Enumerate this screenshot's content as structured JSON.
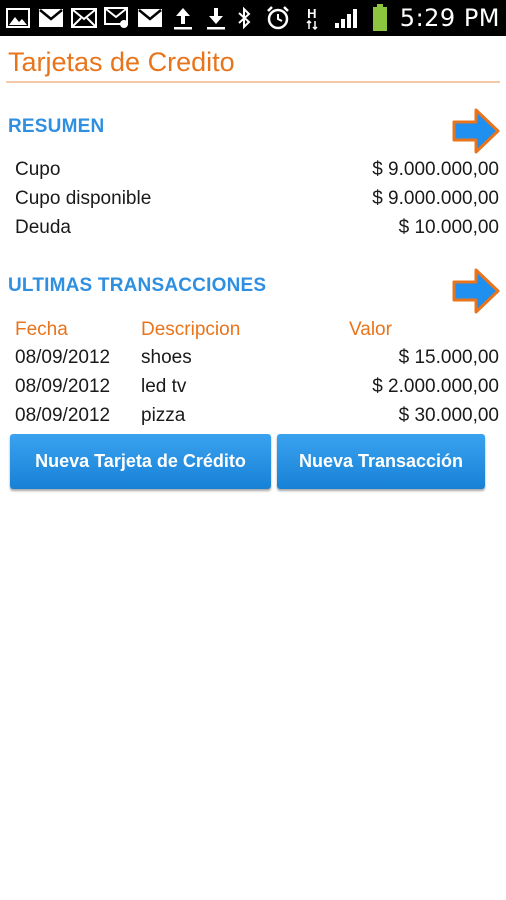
{
  "statusbar": {
    "icons": [
      "image-icon",
      "gmail-icon",
      "email-icon",
      "email-alert-icon",
      "gmail-icon",
      "upload-icon",
      "download-icon",
      "bluetooth-icon",
      "alarm-icon",
      "hspa-icon",
      "signal-icon",
      "battery-icon"
    ],
    "network_label": "H",
    "time": "5:29 PM"
  },
  "page": {
    "title": "Tarjetas de Credito"
  },
  "resumen": {
    "heading": "RESUMEN",
    "rows": [
      {
        "label": "Cupo",
        "value": "$ 9.000.000,00"
      },
      {
        "label": "Cupo disponible",
        "value": "$ 9.000.000,00"
      },
      {
        "label": "Deuda",
        "value": "$ 10.000,00"
      }
    ]
  },
  "transacciones": {
    "heading": "ULTIMAS TRANSACCIONES",
    "columns": {
      "fecha": "Fecha",
      "descripcion": "Descripcion",
      "valor": "Valor"
    },
    "rows": [
      {
        "fecha": "08/09/2012",
        "descripcion": "shoes",
        "valor": "$ 15.000,00"
      },
      {
        "fecha": "08/09/2012",
        "descripcion": "led tv",
        "valor": "$ 2.000.000,00"
      },
      {
        "fecha": "08/09/2012",
        "descripcion": "pizza",
        "valor": "$ 30.000,00"
      }
    ]
  },
  "buttons": {
    "new_card": "Nueva Tarjeta de Crédito",
    "new_transaction": "Nueva Transacción"
  },
  "colors": {
    "accent_orange": "#e8741c",
    "heading_blue": "#2f8fe0",
    "button_blue": "#1781d6"
  }
}
